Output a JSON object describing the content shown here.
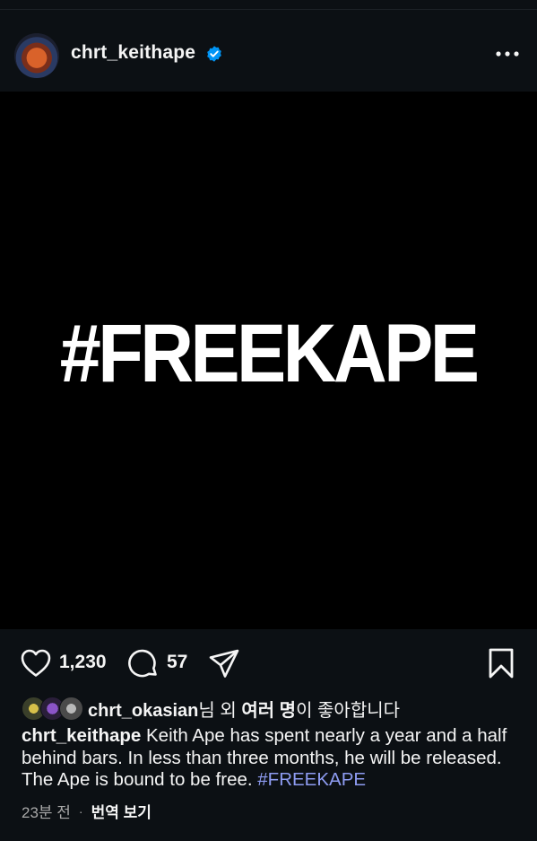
{
  "post": {
    "username": "chrt_keithape",
    "verified": true,
    "image_text": "#FREEKAPE",
    "likes": "1,230",
    "comments": "57",
    "liked_by": {
      "user": "chrt_okasian",
      "suffix_1": "님 외 ",
      "others": "여러 명",
      "suffix_2": "이 좋아합니다"
    },
    "caption": {
      "user": "chrt_keithape",
      "text": " Keith Ape has spent nearly a year and a half behind bars. In less than three months, he will be released. The Ape is bound to be free. ",
      "hashtag": "#FREEKAPE"
    },
    "time_ago": "23분 전",
    "separator": "·",
    "translate_label": "번역 보기"
  },
  "icons": {
    "verified": "verified-badge-icon",
    "more": "more-options-icon",
    "like": "heart-icon",
    "comment": "comment-icon",
    "share": "send-icon",
    "save": "bookmark-icon"
  },
  "colors": {
    "background": "#0c1014",
    "text": "#f5f5f5",
    "secondary_text": "#a8a8a8",
    "hashtag": "#8e9cf2",
    "verified_blue": "#0095f6"
  }
}
